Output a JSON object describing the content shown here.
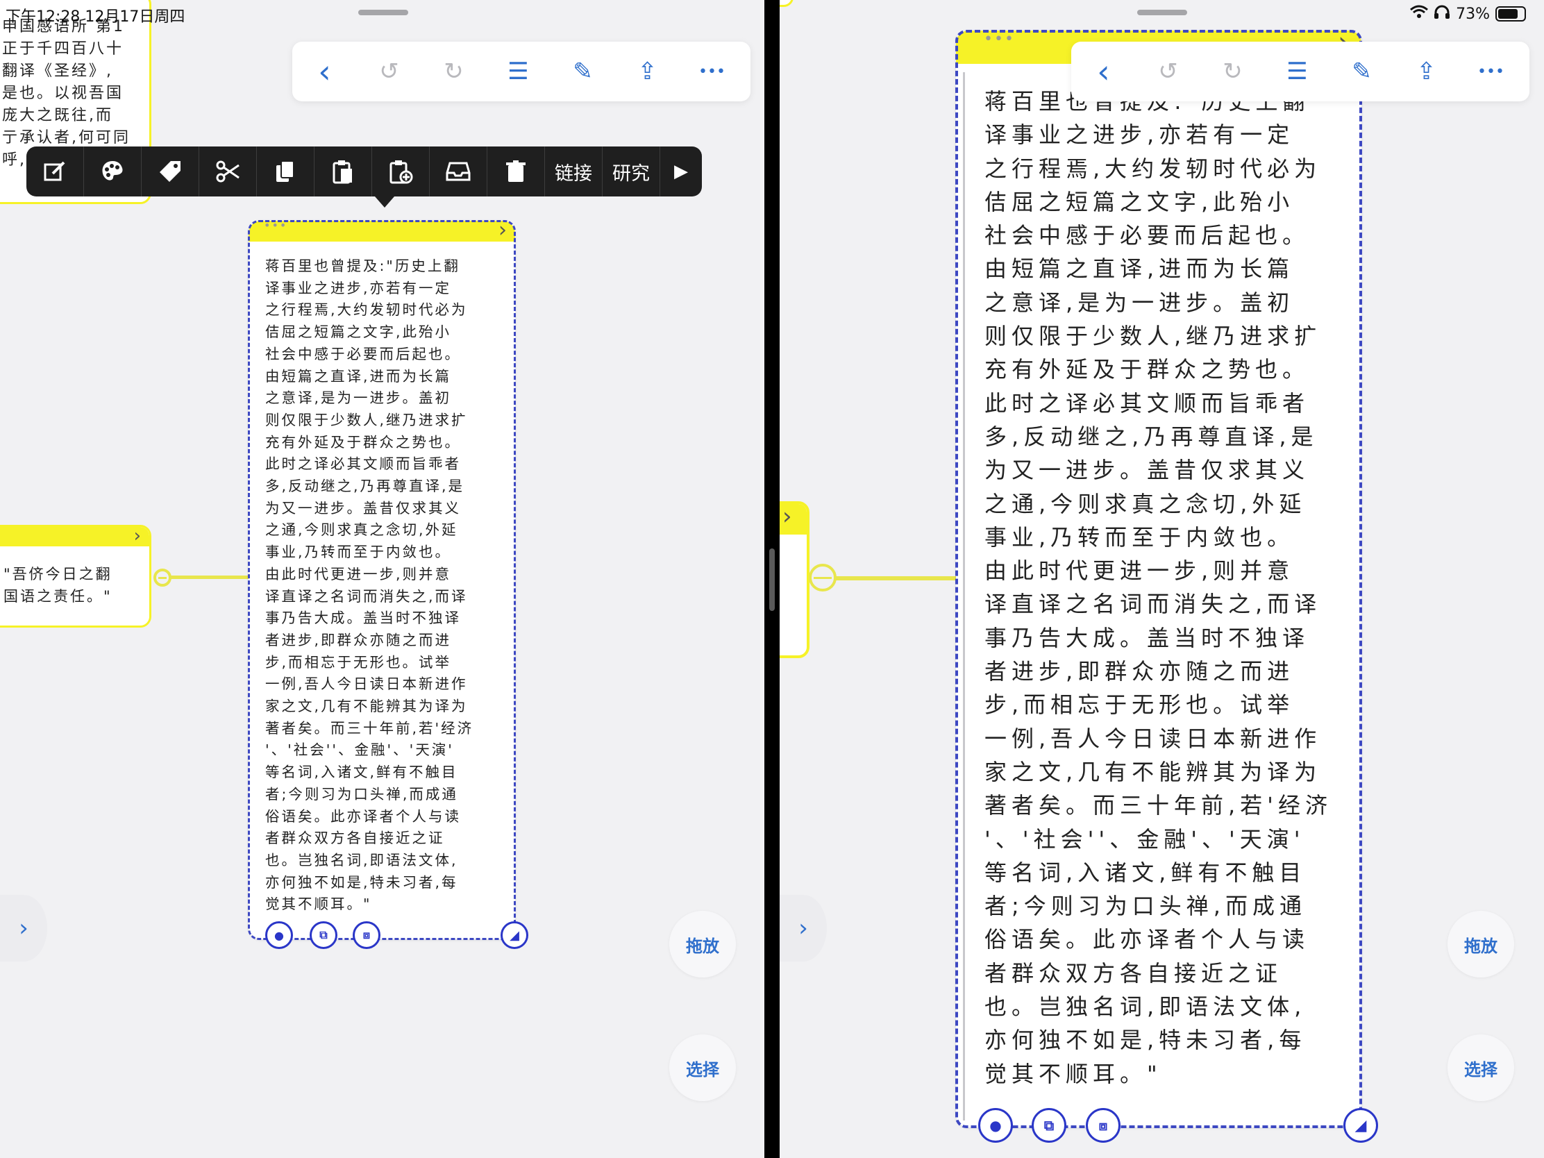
{
  "status": {
    "time": "下午12:28 12月17日周四",
    "battery": "73%"
  },
  "toolbar": {
    "back": "‹",
    "undo": "↺",
    "redo": "↻",
    "list": "☰",
    "edit": "✎",
    "share": "⇪",
    "more": "•••"
  },
  "context_menu": {
    "link": "链接",
    "research": "研究",
    "items_icons": [
      "edit-icon",
      "palette-icon",
      "tag-icon",
      "scissors-icon",
      "copy-icon",
      "paste-icon",
      "paste-add-icon",
      "inbox-icon",
      "trash-icon"
    ]
  },
  "left": {
    "top_snippet": "申国感语所 第1\n正于千四百八十\n翻译《圣经》,\n是也。以视吾国\n庞大之既往,而\n亍承认者,何可同\n呼,岂非可惭者",
    "quote_snippet": "\"吾侪今日之翻\n国语之责任。\"",
    "drag_label": "拖放",
    "select_label": "选择"
  },
  "right": {
    "drag_label": "拖放",
    "select_label": "选择"
  },
  "card": {
    "dots": "•••",
    "chevron": "›",
    "text_left": "蒋百里也曾提及:\"历史上翻\n译事业之进步,亦若有一定\n之行程焉,大约发轫时代必为\n佶屈之短篇之文字,此殆小\n社会中感于必要而后起也。\n由短篇之直译,进而为长篇\n之意译,是为一进步。盖初\n则仅限于少数人,继乃进求扩\n充有外延及于群众之势也。\n此时之译必其文顺而旨乖者\n多,反动继之,乃再尊直译,是\n为又一进步。盖昔仅求其义\n之通,今则求真之念切,外延\n事业,乃转而至于内敛也。\n由此时代更进一步,则并意\n译直译之名词而消失之,而译\n事乃告大成。盖当时不独译\n者进步,即群众亦随之而进\n步,而相忘于无形也。试举\n一例,吾人今日读日本新进作\n家之文,几有不能辨其为译为\n著者矣。而三十年前,若'经济\n'、'社会''、金融'、'天演'\n等名词,入诸文,鲜有不触目\n者;今则习为口头禅,而成通\n俗语矣。此亦译者个人与读\n者群众双方各自接近之证\n也。岂独名词,即语法文体,\n亦何独不如是,特未习者,每\n觉其不顺耳。\"",
    "text_right": "蒋百里也曾提及:\"历史上翻\n译事业之进步,亦若有一定\n之行程焉,大约发轫时代必为\n佶屈之短篇之文字,此殆小\n社会中感于必要而后起也。\n由短篇之直译,进而为长篇\n之意译,是为一进步。盖初\n则仅限于少数人,继乃进求扩\n充有外延及于群众之势也。\n此时之译必其文顺而旨乖者\n多,反动继之,乃再尊直译,是\n为又一进步。盖昔仅求其义\n之通,今则求真之念切,外延\n事业,乃转而至于内敛也。\n由此时代更进一步,则并意\n译直译之名词而消失之,而译\n事乃告大成。盖当时不独译\n者进步,即群众亦随之而进\n步,而相忘于无形也。试举\n一例,吾人今日读日本新进作\n家之文,几有不能辨其为译为\n著者矣。而三十年前,若'经济\n'、'社会''、金融'、'天演'\n等名词,入诸文,鲜有不触目\n者;今则习为口头禅,而成通\n俗语矣。此亦译者个人与读\n者群众双方各自接近之证\n也。岂独名词,即语法文体,\n亦何独不如是,特未习者,每\n觉其不顺耳。\""
  },
  "colors": {
    "accent": "#2f6fcc",
    "card_header": "#f6f227",
    "selection": "#3d48c2",
    "connector": "#e8e64c"
  }
}
